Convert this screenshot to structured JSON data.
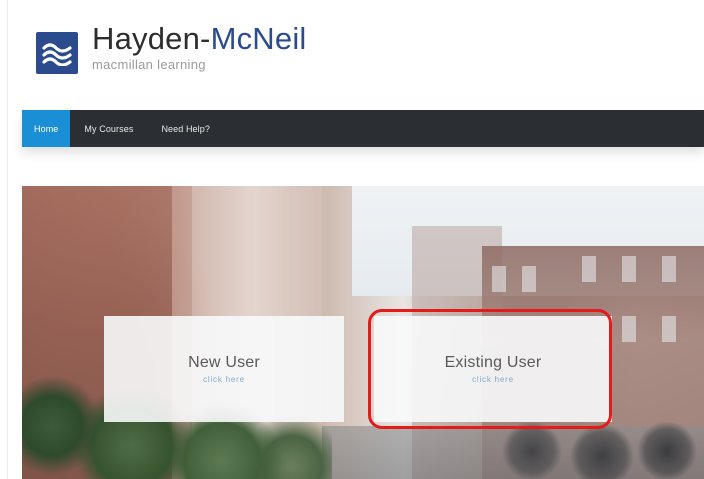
{
  "header": {
    "brand_main": "Hayden-",
    "brand_accent": "McNeil",
    "tagline": "macmillan learning",
    "logo_icon": "waves-logo-icon"
  },
  "nav": {
    "items": [
      {
        "label": "Home",
        "active": true
      },
      {
        "label": "My Courses",
        "active": false
      },
      {
        "label": "Need Help?",
        "active": false
      }
    ]
  },
  "cards": {
    "new_user": {
      "title": "New User",
      "subtitle": "click here"
    },
    "existing_user": {
      "title": "Existing User",
      "subtitle": "click here"
    }
  },
  "colors": {
    "brand_blue": "#2b4b8c",
    "nav_bg": "#2b2e33",
    "nav_active": "#1a8fd6",
    "highlight": "#e31b1b"
  }
}
